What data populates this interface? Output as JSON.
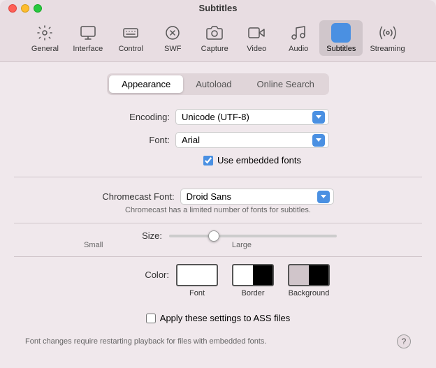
{
  "window": {
    "title": "Subtitles"
  },
  "toolbar": {
    "items": [
      {
        "id": "general",
        "label": "General",
        "icon": "gear"
      },
      {
        "id": "interface",
        "label": "Interface",
        "icon": "interface"
      },
      {
        "id": "control",
        "label": "Control",
        "icon": "keyboard"
      },
      {
        "id": "swf",
        "label": "SWF",
        "icon": "swf"
      },
      {
        "id": "capture",
        "label": "Capture",
        "icon": "camera"
      },
      {
        "id": "video",
        "label": "Video",
        "icon": "video"
      },
      {
        "id": "audio",
        "label": "Audio",
        "icon": "audio"
      },
      {
        "id": "subtitles",
        "label": "Subtitles",
        "icon": "subtitles",
        "active": true
      },
      {
        "id": "streaming",
        "label": "Streaming",
        "icon": "streaming"
      }
    ]
  },
  "tabs": [
    {
      "id": "appearance",
      "label": "Appearance",
      "active": true
    },
    {
      "id": "autoload",
      "label": "Autoload",
      "active": false
    },
    {
      "id": "online_search",
      "label": "Online Search",
      "active": false
    }
  ],
  "form": {
    "encoding_label": "Encoding:",
    "encoding_value": "Unicode (UTF-8)",
    "font_label": "Font:",
    "font_value": "Arial",
    "use_embedded_label": "Use embedded fonts",
    "chromecast_font_label": "Chromecast Font:",
    "chromecast_font_value": "Droid Sans",
    "chromecast_note": "Chromecast has a limited number of fonts for subtitles.",
    "size_label": "Size:",
    "size_small": "Small",
    "size_large": "Large",
    "color_label": "Color:",
    "color_font_label": "Font",
    "color_border_label": "Border",
    "color_background_label": "Background",
    "ass_checkbox_label": "Apply these settings to ASS files"
  },
  "footer": {
    "text": "Font changes require restarting playback for files with embedded fonts.",
    "help_label": "?"
  }
}
